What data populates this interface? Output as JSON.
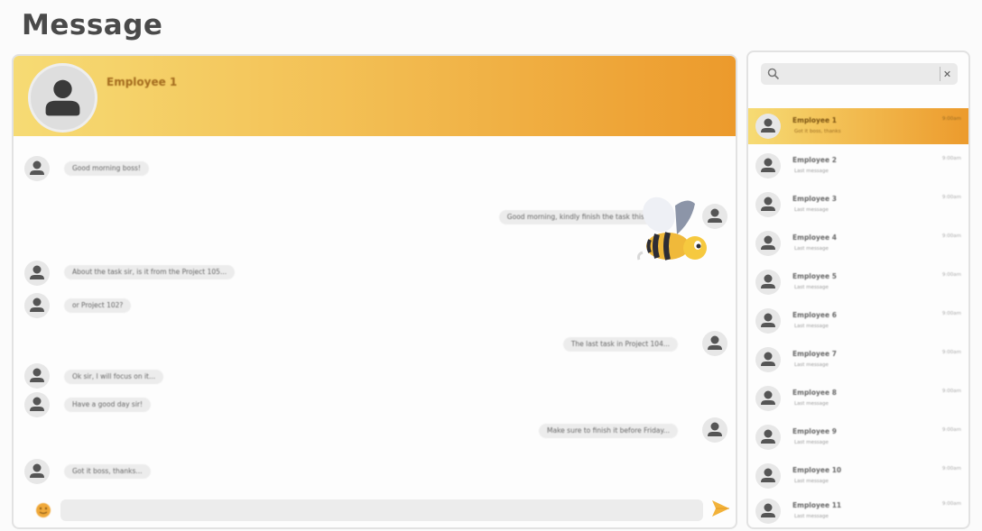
{
  "page": {
    "title": "Message"
  },
  "chat": {
    "contact_name": "Employee 1",
    "messages": [
      {
        "side": "left",
        "text": "Good morning boss!"
      },
      {
        "side": "right",
        "text": "Good morning, kindly finish the task this week"
      },
      {
        "side": "left",
        "text": "About the task sir, is it from the Project 105..."
      },
      {
        "side": "left",
        "text": "or Project 102?"
      },
      {
        "side": "right",
        "text": "The last task in Project 104..."
      },
      {
        "side": "left",
        "text": "Ok sir, I will focus on it..."
      },
      {
        "side": "left",
        "text": "Have a good day sir!"
      },
      {
        "side": "right",
        "text": "Make sure to finish it before Friday..."
      },
      {
        "side": "left",
        "text": "Got it boss, thanks..."
      }
    ],
    "input_placeholder": ""
  },
  "sidebar": {
    "search_placeholder": "",
    "contacts": [
      {
        "name": "Employee 1",
        "preview": "Got it boss, thanks",
        "time": "9:00am",
        "active": true
      },
      {
        "name": "Employee 2",
        "preview": "Last message",
        "time": "9:00am",
        "active": false
      },
      {
        "name": "Employee 3",
        "preview": "Last message",
        "time": "9:00am",
        "active": false
      },
      {
        "name": "Employee 4",
        "preview": "Last message",
        "time": "9:00am",
        "active": false
      },
      {
        "name": "Employee 5",
        "preview": "Last message",
        "time": "9:00am",
        "active": false
      },
      {
        "name": "Employee 6",
        "preview": "Last message",
        "time": "9:00am",
        "active": false
      },
      {
        "name": "Employee 7",
        "preview": "Last message",
        "time": "9:00am",
        "active": false
      },
      {
        "name": "Employee 8",
        "preview": "Last message",
        "time": "9:00am",
        "active": false
      },
      {
        "name": "Employee 9",
        "preview": "Last message",
        "time": "9:00am",
        "active": false
      },
      {
        "name": "Employee 10",
        "preview": "Last message",
        "time": "9:00am",
        "active": false
      },
      {
        "name": "Employee 11",
        "preview": "Last message",
        "time": "9:00am",
        "active": false
      }
    ]
  },
  "colors": {
    "accent_light": "#f6db74",
    "accent_dark": "#ec9a2c"
  },
  "icons": [
    "person-avatar-icon",
    "search-icon",
    "clear-icon",
    "emoji-icon",
    "send-icon",
    "bee-mascot-icon"
  ]
}
